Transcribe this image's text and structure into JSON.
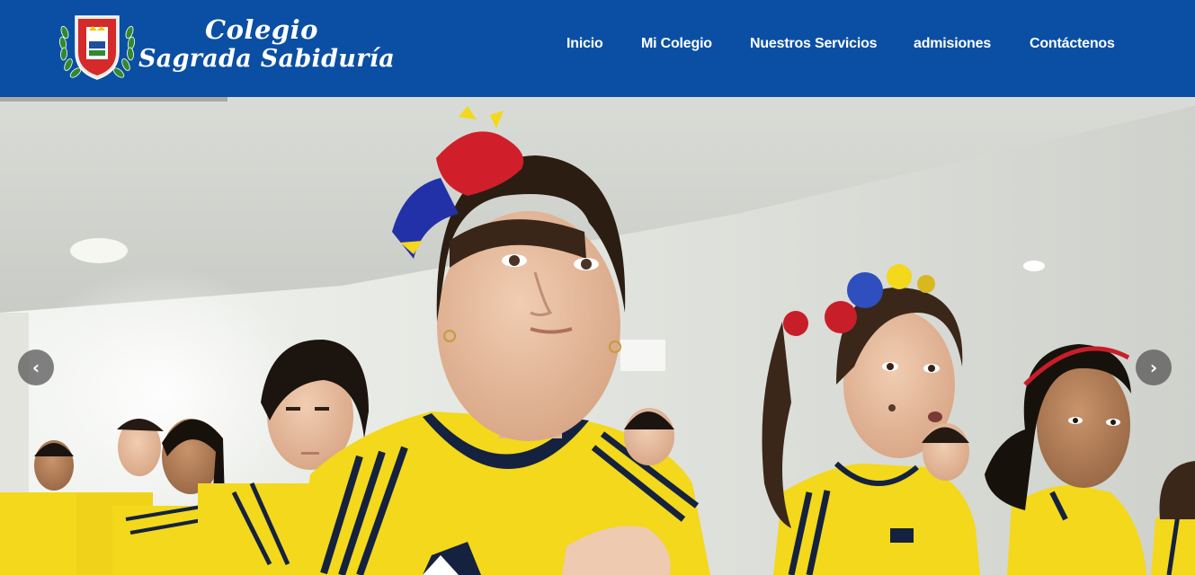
{
  "brand": {
    "line1": "Colegio",
    "line2": "Sagrada Sabiduría"
  },
  "nav": {
    "items": [
      {
        "label": "Inicio"
      },
      {
        "label": "Mi Colegio"
      },
      {
        "label": "Nuestros Servicios"
      },
      {
        "label": "admisiones"
      },
      {
        "label": "Contáctenos"
      }
    ]
  },
  "slider": {
    "prev_glyph": "‹",
    "next_glyph": "›",
    "icons": {
      "prev": "chevron-left-icon",
      "next": "chevron-right-icon"
    },
    "progress_fraction": 0.19
  },
  "colors": {
    "header_bg": "#0a4fa3",
    "nav_text": "#ffffff",
    "jersey_yellow": "#f3d81c",
    "jersey_navy": "#14223f"
  }
}
